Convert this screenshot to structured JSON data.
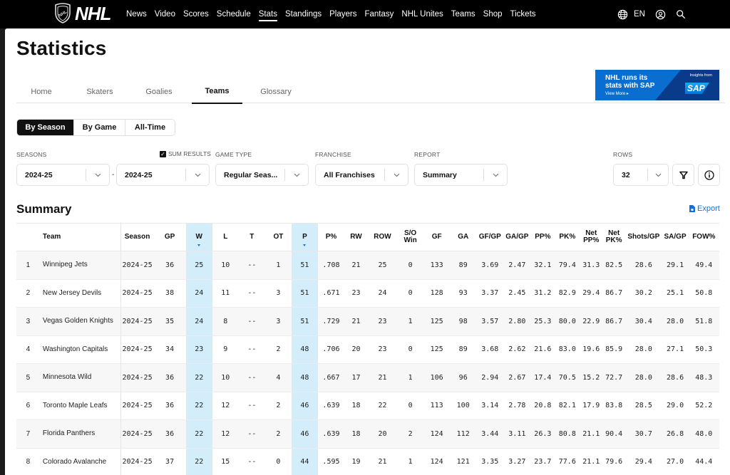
{
  "nav": {
    "brand": "NHL",
    "links": [
      "News",
      "Video",
      "Scores",
      "Schedule",
      "Stats",
      "Standings",
      "Players",
      "Fantasy",
      "NHL Unites",
      "Teams",
      "Shop",
      "Tickets"
    ],
    "active": "Stats",
    "language": "EN",
    "icons": [
      "globe-icon",
      "account-icon",
      "search-icon"
    ]
  },
  "page": {
    "title": "Statistics",
    "tabs": [
      "Home",
      "Skaters",
      "Goalies",
      "Teams",
      "Glossary"
    ],
    "active_tab": "Teams"
  },
  "ad": {
    "headline_1": "NHL runs its",
    "headline_2": "stats with SAP",
    "cta": "View More ▸",
    "insights": "Insights from",
    "brand": "SAP"
  },
  "view_toggle": {
    "options": [
      "By Season",
      "By Game",
      "All-Time"
    ],
    "active": "By Season"
  },
  "filters": {
    "seasons_label": "SEASONS",
    "sum_results_label": "SUM RESULTS",
    "sum_results_checked": true,
    "season_from": "2024-25",
    "season_to": "2024-25",
    "range_separator": "-",
    "game_type_label": "GAME TYPE",
    "game_type": "Regular Seas...",
    "franchise_label": "FRANCHISE",
    "franchise": "All Franchises",
    "report_label": "REPORT",
    "report": "Summary",
    "rows_label": "ROWS",
    "rows": "32"
  },
  "summary": {
    "heading": "Summary",
    "export_label": "Export"
  },
  "table": {
    "columns": [
      "",
      "Team",
      "Season",
      "GP",
      "W",
      "L",
      "T",
      "OT",
      "P",
      "P%",
      "RW",
      "ROW",
      "S/O Win",
      "GF",
      "GA",
      "GF/GP",
      "GA/GP",
      "PP%",
      "PK%",
      "Net PP%",
      "Net PK%",
      "Shots/GP",
      "SA/GP",
      "FOW%"
    ],
    "sorted_columns": [
      "W",
      "P"
    ],
    "rows": [
      [
        "1",
        "Winnipeg Jets",
        "2024-25",
        "36",
        "25",
        "10",
        "--",
        "1",
        "51",
        ".708",
        "21",
        "25",
        "0",
        "133",
        "89",
        "3.69",
        "2.47",
        "32.1",
        "79.4",
        "31.3",
        "82.5",
        "28.6",
        "29.1",
        "49.4"
      ],
      [
        "2",
        "New Jersey Devils",
        "2024-25",
        "38",
        "24",
        "11",
        "--",
        "3",
        "51",
        ".671",
        "23",
        "24",
        "0",
        "128",
        "93",
        "3.37",
        "2.45",
        "31.2",
        "82.9",
        "29.4",
        "86.7",
        "30.2",
        "25.1",
        "50.8"
      ],
      [
        "3",
        "Vegas Golden Knights",
        "2024-25",
        "35",
        "24",
        "8",
        "--",
        "3",
        "51",
        ".729",
        "21",
        "23",
        "1",
        "125",
        "98",
        "3.57",
        "2.80",
        "25.3",
        "80.0",
        "22.9",
        "86.7",
        "30.4",
        "28.0",
        "51.8"
      ],
      [
        "4",
        "Washington Capitals",
        "2024-25",
        "34",
        "23",
        "9",
        "--",
        "2",
        "48",
        ".706",
        "20",
        "23",
        "0",
        "125",
        "89",
        "3.68",
        "2.62",
        "21.6",
        "83.0",
        "19.6",
        "85.9",
        "28.0",
        "27.1",
        "50.3"
      ],
      [
        "5",
        "Minnesota Wild",
        "2024-25",
        "36",
        "22",
        "10",
        "--",
        "4",
        "48",
        ".667",
        "17",
        "21",
        "1",
        "106",
        "96",
        "2.94",
        "2.67",
        "17.4",
        "70.5",
        "15.2",
        "72.7",
        "28.0",
        "28.6",
        "48.3"
      ],
      [
        "6",
        "Toronto Maple Leafs",
        "2024-25",
        "36",
        "22",
        "12",
        "--",
        "2",
        "46",
        ".639",
        "18",
        "22",
        "0",
        "113",
        "100",
        "3.14",
        "2.78",
        "20.8",
        "82.1",
        "17.9",
        "83.8",
        "28.5",
        "29.0",
        "52.2"
      ],
      [
        "7",
        "Florida Panthers",
        "2024-25",
        "36",
        "22",
        "12",
        "--",
        "2",
        "46",
        ".639",
        "18",
        "20",
        "2",
        "124",
        "112",
        "3.44",
        "3.11",
        "26.3",
        "80.8",
        "21.1",
        "90.4",
        "30.7",
        "26.8",
        "48.0"
      ],
      [
        "8",
        "Colorado Avalanche",
        "2024-25",
        "37",
        "22",
        "15",
        "--",
        "0",
        "44",
        ".595",
        "19",
        "21",
        "1",
        "124",
        "121",
        "3.35",
        "3.27",
        "23.7",
        "77.6",
        "21.1",
        "79.6",
        "29.4",
        "27.0",
        "44.4"
      ]
    ]
  },
  "colors": {
    "nav_bg": "#000000",
    "accent": "#1a6fd6",
    "highlight_column": "#d4edfb",
    "sap_blue": "#0a6ed1"
  }
}
